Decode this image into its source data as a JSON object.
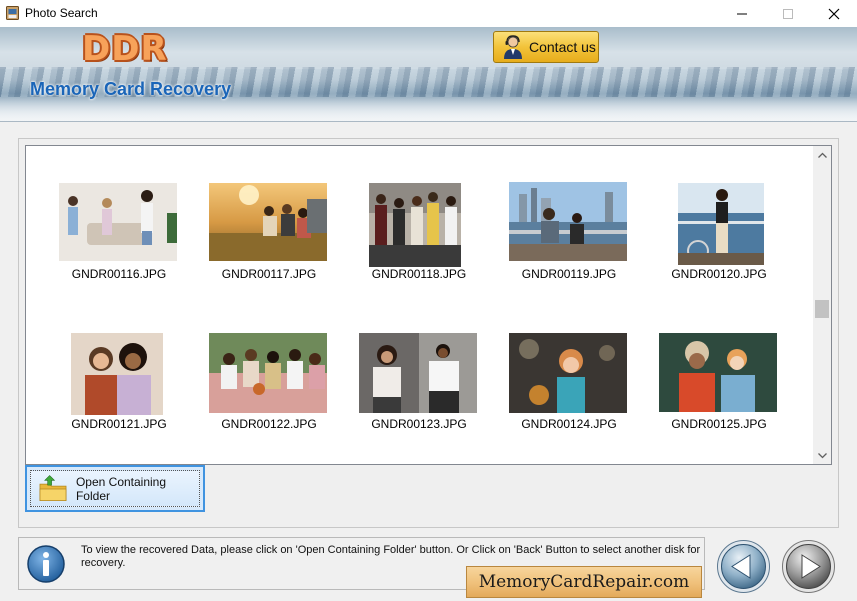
{
  "window": {
    "title": "Photo Search",
    "icon": "photo-app-icon",
    "controls": [
      "minimize",
      "maximize",
      "close"
    ]
  },
  "banner": {
    "logo": "DDR",
    "subtitle": "Memory Card Recovery",
    "contact_label": "Contact us"
  },
  "gallery": {
    "items": [
      {
        "label": "GNDR00116.JPG"
      },
      {
        "label": "GNDR00117.JPG"
      },
      {
        "label": "GNDR00118.JPG"
      },
      {
        "label": "GNDR00119.JPG"
      },
      {
        "label": "GNDR00120.JPG"
      },
      {
        "label": "GNDR00121.JPG"
      },
      {
        "label": "GNDR00122.JPG"
      },
      {
        "label": "GNDR00123.JPG"
      },
      {
        "label": "GNDR00124.JPG"
      },
      {
        "label": "GNDR00125.JPG"
      }
    ]
  },
  "actions": {
    "open_folder_label": "Open Containing Folder"
  },
  "status": {
    "message": "To view the recovered Data, please click on 'Open Containing Folder' button. Or Click on 'Back' Button to select another disk for recovery."
  },
  "brand": {
    "website": "MemoryCardRepair.com"
  },
  "colors": {
    "accent": "#1a65b8",
    "logo": "#f7a25a",
    "contact_button": "#f2c33a",
    "selection_border": "#3f93e0"
  }
}
